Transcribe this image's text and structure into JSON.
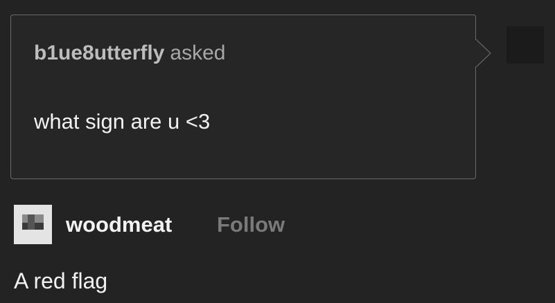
{
  "ask": {
    "asker_name": "b1ue8utterfly",
    "asked_word": "asked",
    "question": "what sign are u <3"
  },
  "answer": {
    "username": "woodmeat",
    "follow_label": "Follow",
    "text": "A red flag"
  },
  "colors": {
    "background": "#232323",
    "box_border": "#6a6a6a",
    "text_primary": "#f2f2f2",
    "follow_muted": "#7a7a7a"
  },
  "icons": {
    "asker_avatar": "asker-avatar-image",
    "answer_avatar": "user-avatar-image"
  }
}
